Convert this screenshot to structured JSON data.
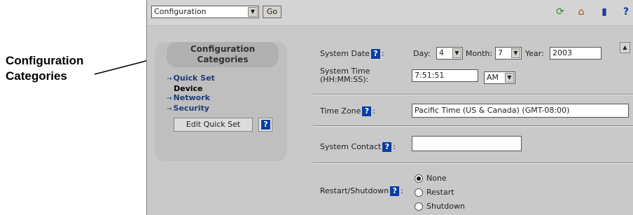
{
  "annotation": {
    "line1": "Configuration",
    "line2": "Categories"
  },
  "topbar": {
    "select_value": "Configuration",
    "go_label": "Go",
    "icons": [
      "refresh-icon",
      "home-icon",
      "book-icon",
      "help-icon"
    ],
    "help_glyph": "?"
  },
  "categories": {
    "title_line1": "Configuration",
    "title_line2": "Categories",
    "items": [
      {
        "label": "Quick Set",
        "link": true
      },
      {
        "label": "Device",
        "link": false
      },
      {
        "label": "Network",
        "link": true
      },
      {
        "label": "Security",
        "link": true
      }
    ],
    "edit_quick_set": "Edit Quick Set",
    "help_glyph": "?"
  },
  "form": {
    "help_glyph": "?",
    "system_date_label": "System Date",
    "day_label": "Day:",
    "day_value": "4",
    "month_label": "Month:",
    "month_value": "7",
    "year_label": "Year:",
    "year_value": "2003",
    "system_time_label_1": "System Time",
    "system_time_label_2": "(HH:MM:SS):",
    "time_value": "7:51:51",
    "ampm_value": "AM",
    "time_zone_label": "Time Zone",
    "time_zone_value": "Pacific Time (US & Canada) (GMT-08:00)",
    "system_contact_label": "System Contact",
    "system_contact_value": "",
    "restart_label": "Restart/Shutdown",
    "restart_options": [
      {
        "label": "None",
        "selected": true
      },
      {
        "label": "Restart",
        "selected": false
      },
      {
        "label": "Shutdown",
        "selected": false
      }
    ]
  }
}
